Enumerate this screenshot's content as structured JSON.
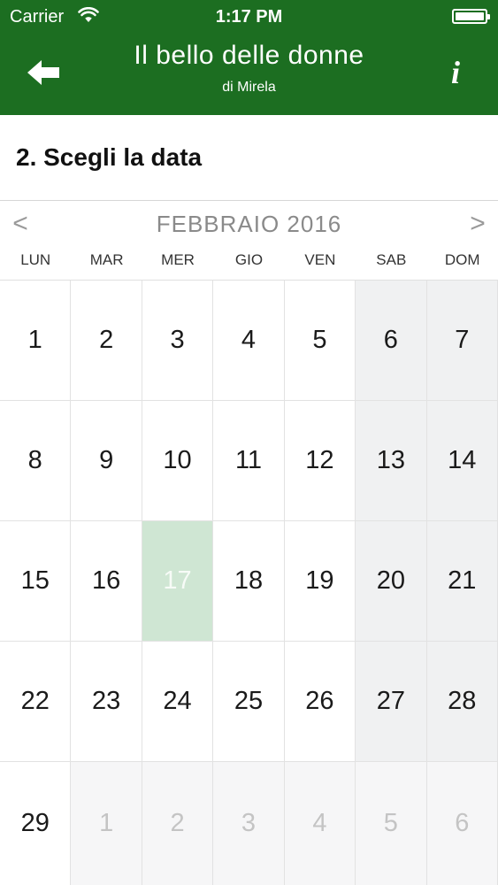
{
  "status_bar": {
    "carrier": "Carrier",
    "time": "1:17 PM"
  },
  "nav": {
    "title": "Il bello delle donne",
    "subtitle": "di Mirela",
    "info_label": "i"
  },
  "section": {
    "title": "2. Scegli la data"
  },
  "calendar": {
    "prev_label": "<",
    "next_label": ">",
    "month_title": "FEBBRAIO 2016",
    "weekdays": [
      "LUN",
      "MAR",
      "MER",
      "GIO",
      "VEN",
      "SAB",
      "DOM"
    ],
    "days": [
      {
        "label": "1",
        "state": "normal"
      },
      {
        "label": "2",
        "state": "normal"
      },
      {
        "label": "3",
        "state": "normal"
      },
      {
        "label": "4",
        "state": "normal"
      },
      {
        "label": "5",
        "state": "normal"
      },
      {
        "label": "6",
        "state": "weekend"
      },
      {
        "label": "7",
        "state": "weekend"
      },
      {
        "label": "8",
        "state": "normal"
      },
      {
        "label": "9",
        "state": "normal"
      },
      {
        "label": "10",
        "state": "normal"
      },
      {
        "label": "11",
        "state": "normal"
      },
      {
        "label": "12",
        "state": "normal"
      },
      {
        "label": "13",
        "state": "weekend"
      },
      {
        "label": "14",
        "state": "weekend"
      },
      {
        "label": "15",
        "state": "normal"
      },
      {
        "label": "16",
        "state": "normal"
      },
      {
        "label": "17",
        "state": "selected"
      },
      {
        "label": "18",
        "state": "normal"
      },
      {
        "label": "19",
        "state": "normal"
      },
      {
        "label": "20",
        "state": "weekend"
      },
      {
        "label": "21",
        "state": "weekend"
      },
      {
        "label": "22",
        "state": "normal"
      },
      {
        "label": "23",
        "state": "normal"
      },
      {
        "label": "24",
        "state": "normal"
      },
      {
        "label": "25",
        "state": "normal"
      },
      {
        "label": "26",
        "state": "normal"
      },
      {
        "label": "27",
        "state": "weekend"
      },
      {
        "label": "28",
        "state": "weekend"
      },
      {
        "label": "29",
        "state": "normal"
      },
      {
        "label": "1",
        "state": "other"
      },
      {
        "label": "2",
        "state": "other"
      },
      {
        "label": "3",
        "state": "other"
      },
      {
        "label": "4",
        "state": "other"
      },
      {
        "label": "5",
        "state": "other"
      },
      {
        "label": "6",
        "state": "other"
      }
    ]
  },
  "colors": {
    "header": "#1c6e21",
    "selected_day": "#cfe6d3",
    "weekend_day": "#f0f1f2",
    "other_month_day": "#f6f6f7"
  },
  "icons": {
    "back": "back-arrow-icon",
    "info": "info-icon",
    "wifi": "wifi-icon",
    "battery": "battery-icon"
  }
}
